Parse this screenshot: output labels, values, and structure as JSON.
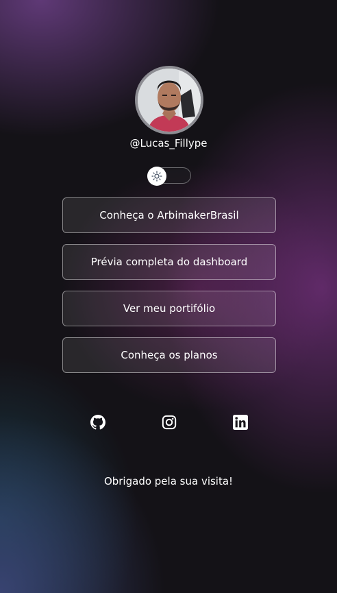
{
  "profile": {
    "username": "@Lucas_Fillype"
  },
  "theme_toggle": {
    "mode": "light",
    "icon": "sun-icon"
  },
  "links": [
    {
      "label": "Conheça o ArbimakerBrasil"
    },
    {
      "label": "Prévia completa do dashboard"
    },
    {
      "label": "Ver meu portifólio"
    },
    {
      "label": "Conheça os planos"
    }
  ],
  "social": [
    {
      "icon": "github-icon"
    },
    {
      "icon": "instagram-icon"
    },
    {
      "icon": "linkedin-icon"
    }
  ],
  "footer": {
    "message": "Obrigado pela sua visita!"
  },
  "colors": {
    "background": "#141217",
    "accent_purple": "#7a3282",
    "button_border": "#8a8590",
    "text": "#ffffff"
  }
}
